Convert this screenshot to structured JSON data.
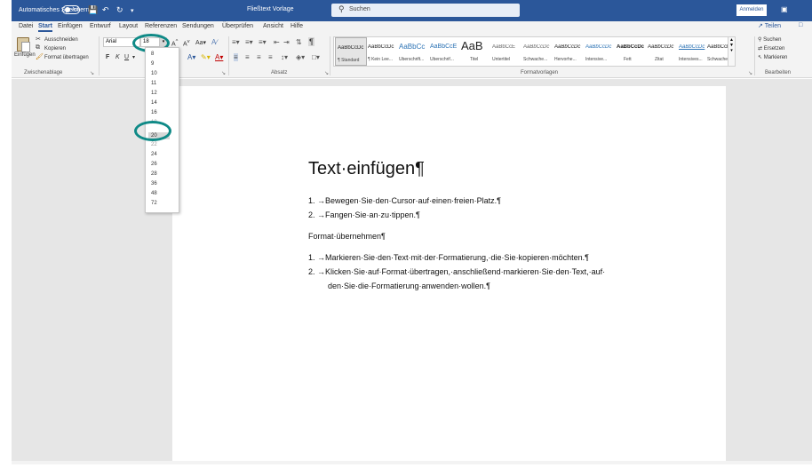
{
  "titlebar": {
    "autosave_label": "Automatisches Speichern",
    "autosave_state": "Aus",
    "doc_title": "Fließtext Vorlage",
    "search_placeholder": "Suchen",
    "signin_label": "Anmelden"
  },
  "tabs": {
    "file": "Datei",
    "home": "Start",
    "insert": "Einfügen",
    "design": "Entwurf",
    "layout": "Layout",
    "references": "Referenzen",
    "mailings": "Sendungen",
    "review": "Überprüfen",
    "view": "Ansicht",
    "help": "Hilfe",
    "share": "Teilen"
  },
  "ribbon": {
    "clipboard": {
      "paste": "Einfügen",
      "cut": "Ausschneiden",
      "copy": "Kopieren",
      "format_painter": "Format übertragen",
      "group_label": "Zwischenablage"
    },
    "font": {
      "font_name": "Arial",
      "font_size": "18",
      "bold": "F",
      "italic": "K",
      "underline": "U"
    },
    "paragraph": {
      "group_label": "Absatz"
    },
    "styles": {
      "group_label": "Formatvorlagen",
      "items": [
        {
          "preview": "AaBbCcDc",
          "name": "¶ Standard"
        },
        {
          "preview": "AaBbCcDc",
          "name": "¶ Kein Lee..."
        },
        {
          "preview": "AaBbCc",
          "name": "Überschrift..."
        },
        {
          "preview": "AaBbCcE",
          "name": "Überschrif..."
        },
        {
          "preview": "AaB",
          "name": "Titel"
        },
        {
          "preview": "AaBbCcE",
          "name": "Untertitel"
        },
        {
          "preview": "AaBbCcDc",
          "name": "Schwache..."
        },
        {
          "preview": "AaBbCcDc",
          "name": "Hervorhe..."
        },
        {
          "preview": "AaBbCcDc",
          "name": "Intensive..."
        },
        {
          "preview": "AaBbCcDc",
          "name": "Fett"
        },
        {
          "preview": "AaBbCcDc",
          "name": "Zitat"
        },
        {
          "preview": "AaBbCcDc",
          "name": "Intensives..."
        },
        {
          "preview": "AaBbCcDc",
          "name": "Schwache..."
        }
      ]
    },
    "editing": {
      "find": "Suchen",
      "replace": "Ersetzen",
      "select": "Markieren",
      "group_label": "Bearbeiten"
    }
  },
  "font_size_dropdown": {
    "options": [
      "8",
      "9",
      "10",
      "11",
      "12",
      "14",
      "16",
      "18",
      "20",
      "22",
      "24",
      "26",
      "28",
      "36",
      "48",
      "72"
    ],
    "hovered": "20"
  },
  "document": {
    "heading": "Text·einfügen¶",
    "list1": [
      {
        "num": "1.",
        "text": "→Bewegen·Sie·den·Cursor·auf·einen·freien·Platz.¶"
      },
      {
        "num": "2.",
        "text": "→Fangen·Sie·an·zu·tippen.¶"
      }
    ],
    "paragraph": "Format·übernehmen¶",
    "list2": [
      {
        "num": "1.",
        "text": "→Markieren·Sie·den·Text·mit·der·Formatierung,·die·Sie·kopieren·möchten.¶"
      },
      {
        "num": "2.",
        "text": "→Klicken·Sie·auf·Format·übertragen,·anschließend·markieren·Sie·den·Text,·auf·",
        "continuation": "den·Sie·die·Formatierung·anwenden·wollen.¶"
      }
    ]
  },
  "colors": {
    "titlebar": "#2b579a",
    "ribbon": "#f3f3f3",
    "workspace": "#e6e6e6",
    "highlight_circle": "#0f8a87"
  }
}
